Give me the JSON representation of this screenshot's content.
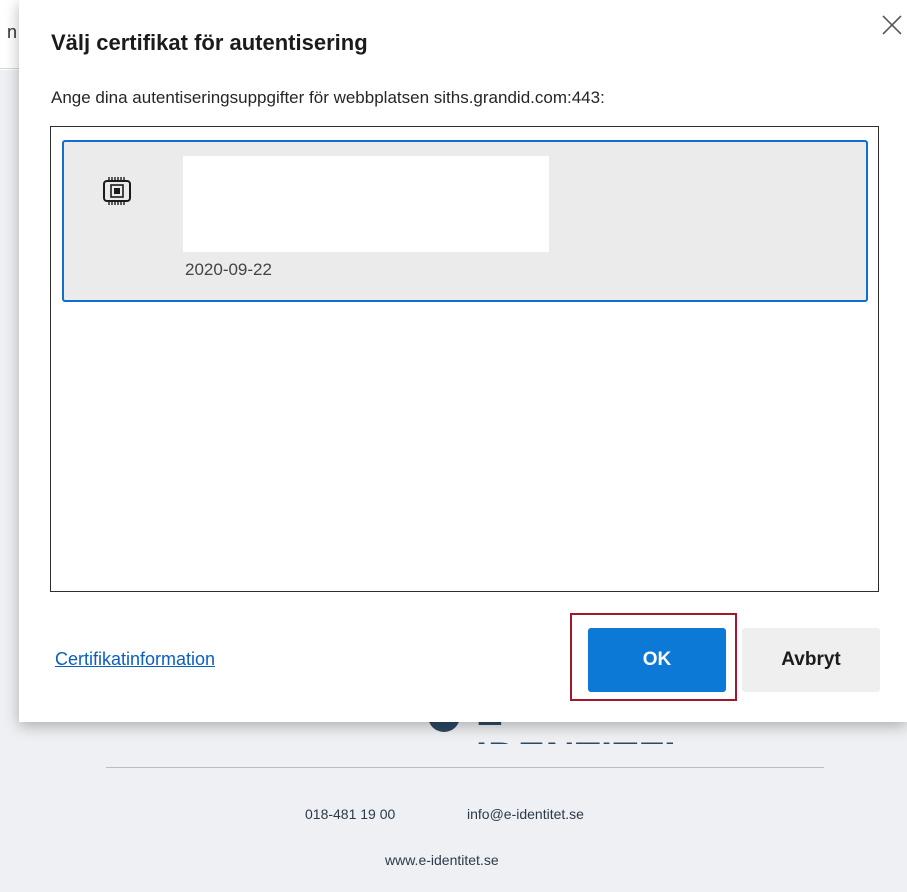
{
  "background": {
    "top_char": "n",
    "logo_text": "E-IDENTITET",
    "footer": {
      "phone": "018-481 19 00",
      "email": "info@e-identitet.se",
      "website": "www.e-identitet.se"
    }
  },
  "dialog": {
    "title": "Välj certifikat för autentisering",
    "subtitle": "Ange dina autentiseringsuppgifter för webbplatsen siths.grandid.com:443:",
    "close_icon": "close-icon",
    "certificates": [
      {
        "icon": "smart-card-chip-icon",
        "date": "2020-09-22",
        "selected": true
      }
    ],
    "cert_info_link": "Certifikatinformation",
    "ok_label": "OK",
    "cancel_label": "Avbryt"
  },
  "colors": {
    "accent": "#0c79d6",
    "selection_border": "#0e6fd1",
    "highlight_frame": "#a4162b",
    "link": "#0a5fc0"
  }
}
